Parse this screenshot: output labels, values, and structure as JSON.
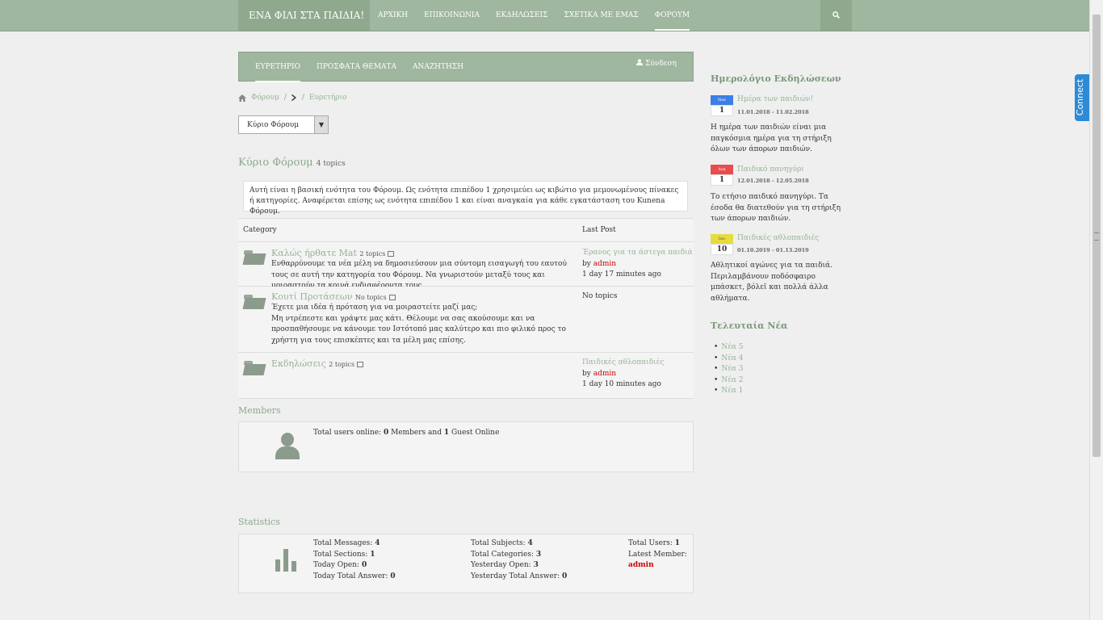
{
  "brand": "ΕΝΑ ΦΙΛΙ ΣΤΑ ΠΑΙΔΙΑ!",
  "topnav": [
    "ΑΡΧΙΚΗ",
    "ΕΠΙΚΟΙΝΩΝΙΑ",
    "ΕΚΔΗΛΩΣΕΙΣ",
    "ΣΧΕΤΙΚΑ ΜΕ ΕΜΑΣ",
    "ΦΟΡΟΥΜ"
  ],
  "connect_label": "Connect",
  "forum_tabs": [
    "ΕΥΡΕΤΗΡΙΟ",
    "ΠΡΟΣΦΑΤΑ ΘΕΜΑΤΑ",
    "ΑΝΑΖΗΤΗΣΗ"
  ],
  "login_label": "Σύνδεση",
  "breadcrumb": {
    "home": "Φόρουμ",
    "sep": "/",
    "current": "Ευρετήριο"
  },
  "select_value": "Κύριο Φόρουμ",
  "section": {
    "title": "Κύριο Φόρουμ",
    "count": "4 topics"
  },
  "description": "Αυτή είναι η βασική ενότητα του Φόρουμ. Ως ενότητα επιπέδου 1 χρησιμεύει ως κιβώτιο για μεμονωμένους πίνακες ή κατηγορίες. Αναφέρεται επίσης ως ενότητα επιπέδου 1 και είναι αναγκαία για κάθε εγκατάσταση του Kunena Φόρουμ.",
  "table_headers": {
    "category": "Category",
    "last_post": "Last Post"
  },
  "categories": [
    {
      "name": "Καλώς ήρθατε Mat",
      "count": "2 topics",
      "desc": "Ενθαρρύνουμε τα νέα μέλη να δημοσιεύσουν μια σύντομη εισαγωγή του εαυτού τους σε αυτή την κατηγορία του Φόρουμ. Να γνωριστούν μεταξύ τους και μοιραστούν τα κοινά ενδιαφέροντα τους.",
      "last_title": "Έρανος για τα άστεγα παιδιά",
      "last_by": "by",
      "last_user": "admin",
      "last_time": "1 day 17 minutes ago"
    },
    {
      "name": "Κουτί Προτάσεων",
      "count": "No topics",
      "desc1": "Έχετε μια ιδέα ή πρόταση για να μοιραστείτε μαζί μας;",
      "desc2": "Μη ντρέπεστε και γράψτε μας κάτι. Θέλουμε να σας ακούσουμε και να προσπαθήσουμε να κάνουμε τον Ιστότοπό μας καλύτερο και πιο φιλικό προς το χρήστη για τους επισκέπτες και τα μέλη μας επίσης.",
      "last_none": "No topics"
    },
    {
      "name": "Εκδηλώσεις",
      "count": "2 topics",
      "last_title": "Παιδικές αθλοπαιδιές",
      "last_by": "by",
      "last_user": "admin",
      "last_time": "1 day 10 minutes ago"
    }
  ],
  "members": {
    "title": "Members",
    "text_prefix": "Total users online: ",
    "members_count": "0",
    "text_mid": " Members and ",
    "guests_count": "1",
    "text_suffix": " Guest Online"
  },
  "statistics": {
    "title": "Statistics",
    "col1": [
      {
        "label": "Total Messages: ",
        "value": "4"
      },
      {
        "label": "Total Sections: ",
        "value": "1"
      },
      {
        "label": "Today Open: ",
        "value": "0"
      },
      {
        "label": "Today Total Answer: ",
        "value": "0"
      }
    ],
    "col2": [
      {
        "label": "Total Subjects: ",
        "value": "4"
      },
      {
        "label": "Total Categories: ",
        "value": "3"
      },
      {
        "label": "Yesterday Open: ",
        "value": "3"
      },
      {
        "label": "Yesterday Total Answer: ",
        "value": "0"
      }
    ],
    "col3": [
      {
        "label": "Total Users: ",
        "value": "1"
      },
      {
        "label": "Latest Member: ",
        "value": "admin"
      }
    ],
    "bar_levels": [
      0.55,
      1.0,
      0.45
    ]
  },
  "sidebar": {
    "events_title": "Ημερολόγιο Εκδηλώσεων",
    "events": [
      {
        "month": "Νοε",
        "day": "1",
        "title": "Ημέρα των παιδιών!",
        "dates": "11.01.2018 - 11.02.2018",
        "desc": "Η ημέρα των παιδιών είναι μια παγκόσμια ημέρα για τη στήριξη όλων των άπορων παιδιών.",
        "color": "#3d7fe6"
      },
      {
        "month": "Δεκ",
        "day": "1",
        "title": "Παιδικό πανηγύρι",
        "dates": "12.01.2018 - 12.05.2018",
        "desc": "Το ετήσιο παιδικό πανηγύρι. Τα έσοδα θα διατεθούν για τη στήριξη των άπορων παιδιών.",
        "color": "#e84c4c"
      },
      {
        "month": "Ιαν",
        "day": "10",
        "title": "Παιδικές αθλοπαιδιές",
        "dates": "01.10.2019 - 01.13.2019",
        "desc": "Αθλητικοί αγώνες για τα παιδιά. Περιλαμβάνουν ποδόσφαιρο μπάσκετ, βόλεϊ και πολλά άλλα αθλήματα.",
        "color": "#e6dc3d"
      }
    ],
    "news_title": "Τελευταία Νέα",
    "news": [
      "Νέα 5",
      "Νέα 4",
      "Νέα 3",
      "Νέα 2",
      "Νέα 1"
    ]
  }
}
